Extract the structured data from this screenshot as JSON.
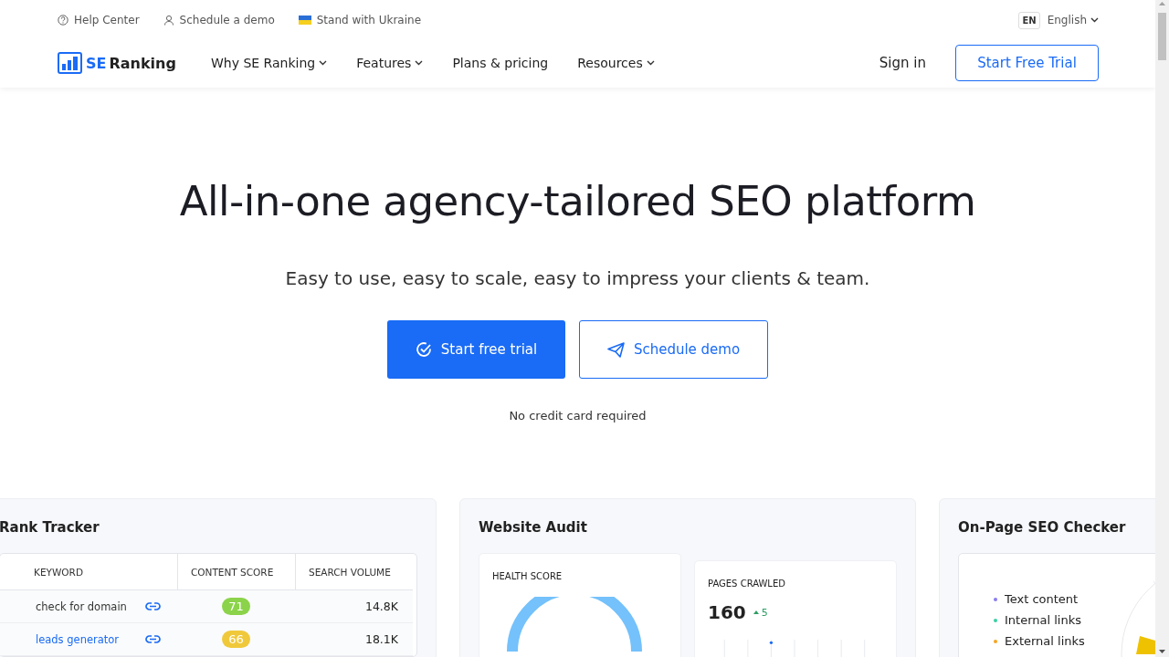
{
  "topbar": {
    "links": [
      {
        "kind": "help",
        "label": "Help Center"
      },
      {
        "kind": "person",
        "label": "Schedule a demo"
      },
      {
        "kind": "flag",
        "label": "Stand with Ukraine"
      }
    ],
    "language": {
      "code": "EN",
      "label": "English"
    }
  },
  "nav": {
    "logo": {
      "brand": "SE",
      "name": "Ranking"
    },
    "items": [
      {
        "label": "Why SE Ranking",
        "dropdown": true
      },
      {
        "label": "Features",
        "dropdown": true
      },
      {
        "label": "Plans & pricing",
        "dropdown": false
      },
      {
        "label": "Resources",
        "dropdown": true
      }
    ],
    "sign_in": "Sign in",
    "cta": "Start Free Trial"
  },
  "hero": {
    "title": "All-in-one agency-tailored SEO platform",
    "subtitle": "Easy to use, easy to scale, easy to impress your clients & team.",
    "primary": "Start free trial",
    "secondary": "Schedule demo",
    "note": "No credit card required"
  },
  "rank_tracker": {
    "title": "Rank Tracker",
    "columns": [
      "KEYWORD",
      "CONTENT SCORE",
      "SEARCH VOLUME"
    ],
    "rows": [
      {
        "keyword": "check for domain",
        "hovered": false,
        "score": "71",
        "color": "#8bd34a",
        "volume": "14.8K"
      },
      {
        "keyword": "leads generator",
        "hovered": true,
        "score": "66",
        "color": "#f0c93b",
        "volume": "18.1K"
      }
    ]
  },
  "website_audit": {
    "title": "Website Audit",
    "health_label": "HEALTH SCORE",
    "pages_label": "PAGES CRAWLED",
    "pages_value": "160",
    "pages_delta": "5"
  },
  "onpage": {
    "title": "On-Page SEO Checker",
    "legend": [
      {
        "label": "Text content",
        "color": "#8a7cf0"
      },
      {
        "label": "Internal links",
        "color": "#3ccfa6"
      },
      {
        "label": "External links",
        "color": "#f5a524"
      }
    ]
  }
}
